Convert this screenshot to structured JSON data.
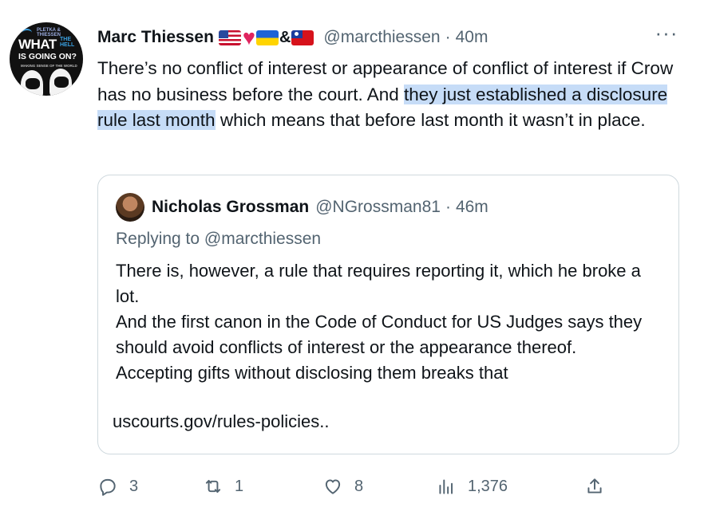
{
  "tweet": {
    "author": {
      "name": "Marc Thiessen",
      "handle": "@marcthiessen",
      "time": "40m",
      "emoji_ampersand": "&",
      "avatar_text": {
        "brand": "PLETKA & THIESSEN",
        "what": "WHAT",
        "the_hell": "THE HELL",
        "going": "IS GOING ON?",
        "tagline": "MAKING SENSE OF THE WORLD"
      }
    },
    "dot": "·",
    "more_label": "···",
    "body": {
      "part1": "There’s no conflict of interest or appearance of conflict of interest if Crow has no business before the court. And ",
      "highlight": "they just established a disclosure rule last month",
      "part2": " which means that before last month it wasn’t in place."
    },
    "quote": {
      "name": "Nicholas Grossman",
      "handle": "@NGrossman81",
      "time": "46m",
      "replying_to": "Replying to @marcthiessen",
      "lines": [
        "There is, however, a rule that requires reporting it, which he broke a lot.",
        "And the first canon in the Code of Conduct for US Judges says they should avoid conflicts of interest or the appearance thereof.",
        "Accepting gifts without disclosing them breaks that"
      ],
      "link": "uscourts.gov/rules-policies.."
    },
    "actions": {
      "replies": "3",
      "retweets": "1",
      "likes": "8",
      "views": "1,376"
    }
  },
  "colors": {
    "text": "#0f1419",
    "secondary": "#536471",
    "highlight": "#c6dcf7",
    "border": "#cfd9de"
  }
}
